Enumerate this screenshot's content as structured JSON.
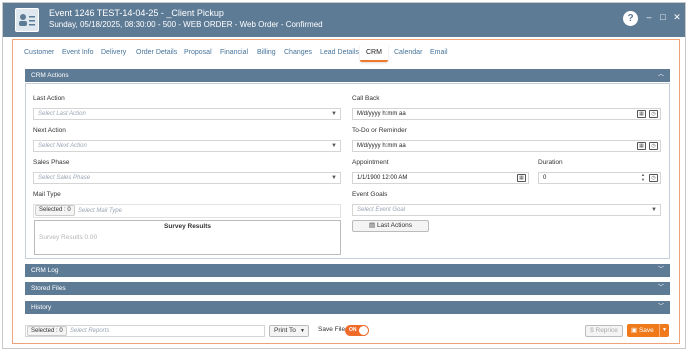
{
  "window": {
    "title": "Event 1246 TEST-14-04-25 - _Client Pickup",
    "subtitle": "Sunday, 05/18/2025, 08:30:00 - 500 - WEB ORDER - Web Order - Confirmed",
    "help": "?",
    "minimize": "–",
    "maximize": "□",
    "close": "✕"
  },
  "tabs": [
    "Customer",
    "Event Info",
    "Delivery",
    "Order Details",
    "Proposal",
    "Financial",
    "Billing",
    "Changes",
    "Lead Details",
    "CRM",
    "Calendar",
    "Email"
  ],
  "active_tab": "CRM",
  "crm_actions": {
    "header": "CRM Actions",
    "last_action": {
      "label": "Last Action",
      "placeholder": "Select Last Action"
    },
    "next_action": {
      "label": "Next Action",
      "placeholder": "Select Next Action"
    },
    "sales_phase": {
      "label": "Sales Phase",
      "placeholder": "Select Sales Phase"
    },
    "mail_type": {
      "label": "Mail Type",
      "selected": "Selected : 0",
      "placeholder": "Select Mail Type"
    },
    "survey": {
      "title": "Survey Results",
      "text": "Survey Results 0.00"
    },
    "call_back": {
      "label": "Call Back",
      "value": "M/d/yyyy h:mm aa"
    },
    "todo": {
      "label": "To-Do or Reminder",
      "value": "M/d/yyyy h:mm aa"
    },
    "appointment": {
      "label": "Appointment",
      "value": "1/1/1900 12:00 AM"
    },
    "duration": {
      "label": "Duration",
      "value": "0"
    },
    "event_goals": {
      "label": "Event Goals",
      "placeholder": "Select Event Goal"
    },
    "last_actions_button": "Last Actions"
  },
  "panels": {
    "crm_log": "CRM Log",
    "stored_files": "Stored Files",
    "history": "History"
  },
  "footer": {
    "selected": "Selected : 0",
    "reports_placeholder": "Select Reports",
    "print_to": "Print To",
    "save_file": "Save File",
    "toggle": "ON",
    "reprice": "Reprice",
    "save": "Save"
  },
  "colors": {
    "header": "#5e7b96",
    "accent": "#f07a1a"
  }
}
